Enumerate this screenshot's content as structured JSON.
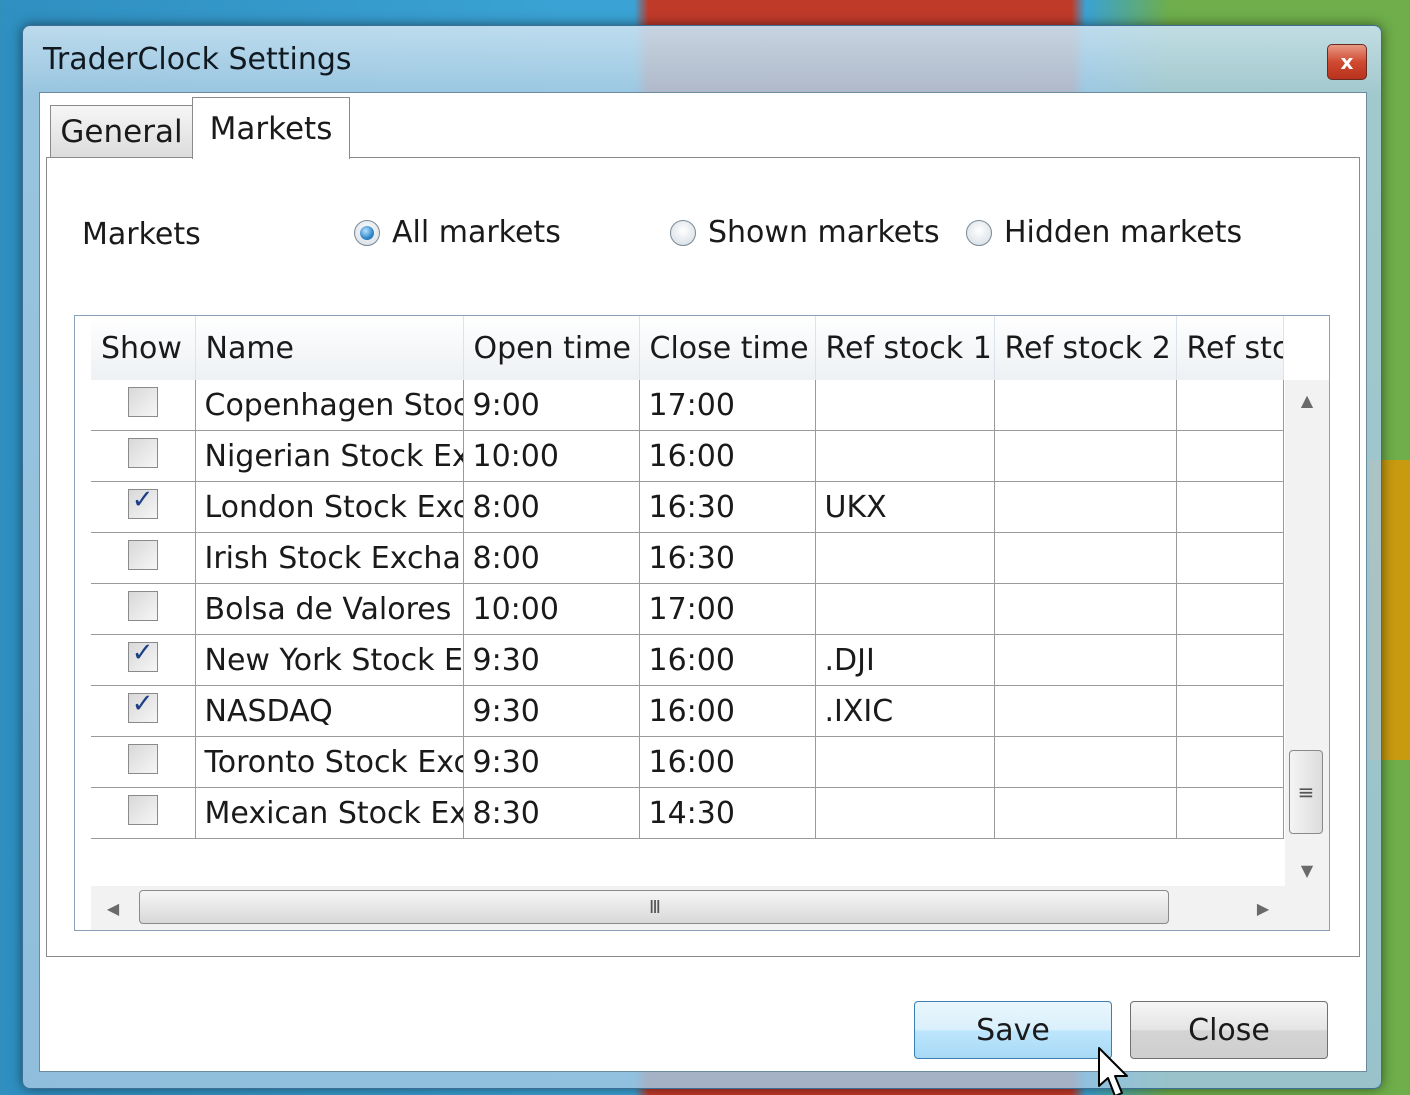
{
  "window": {
    "title": "TraderClock Settings",
    "close_glyph": "x"
  },
  "tabs": [
    {
      "label": "General",
      "selected": false
    },
    {
      "label": "Markets",
      "selected": true
    }
  ],
  "filter": {
    "label": "Markets",
    "options": [
      {
        "label": "All markets",
        "checked": true
      },
      {
        "label": "Shown markets",
        "checked": false
      },
      {
        "label": "Hidden markets",
        "checked": false
      }
    ]
  },
  "grid": {
    "columns": [
      "Show",
      "Name",
      "Open time",
      "Close time",
      "Ref stock 1",
      "Ref stock 2",
      "Ref stc"
    ],
    "rows": [
      {
        "show": false,
        "name": "Copenhagen Stoc",
        "open": "9:00",
        "close": "17:00",
        "ref1": "",
        "ref2": "",
        "ref3": ""
      },
      {
        "show": false,
        "name": "Nigerian Stock Ex",
        "open": "10:00",
        "close": "16:00",
        "ref1": "",
        "ref2": "",
        "ref3": ""
      },
      {
        "show": true,
        "name": "London Stock Exc",
        "open": "8:00",
        "close": "16:30",
        "ref1": "UKX",
        "ref2": "",
        "ref3": ""
      },
      {
        "show": false,
        "name": "Irish Stock Exchan",
        "open": "8:00",
        "close": "16:30",
        "ref1": "",
        "ref2": "",
        "ref3": ""
      },
      {
        "show": false,
        "name": "Bolsa de Valores (",
        "open": "10:00",
        "close": "17:00",
        "ref1": "",
        "ref2": "",
        "ref3": ""
      },
      {
        "show": true,
        "name": "New York Stock E",
        "open": "9:30",
        "close": "16:00",
        "ref1": ".DJI",
        "ref2": "",
        "ref3": ""
      },
      {
        "show": true,
        "name": "NASDAQ",
        "open": "9:30",
        "close": "16:00",
        "ref1": ".IXIC",
        "ref2": "",
        "ref3": ""
      },
      {
        "show": false,
        "name": "Toronto Stock Exc",
        "open": "9:30",
        "close": "16:00",
        "ref1": "",
        "ref2": "",
        "ref3": ""
      },
      {
        "show": false,
        "name": "Mexican Stock Ex",
        "open": "8:30",
        "close": "14:30",
        "ref1": "",
        "ref2": "",
        "ref3": ""
      }
    ],
    "check_glyph": "✓",
    "vscroll_thumb_glyph": "≡",
    "hscroll_thumb_glyph": "III"
  },
  "buttons": {
    "save_label": "Save",
    "close_label": "Close"
  },
  "colors": {
    "save_accent": "#3c7fb1",
    "close_button_red": "#cf4a30"
  }
}
